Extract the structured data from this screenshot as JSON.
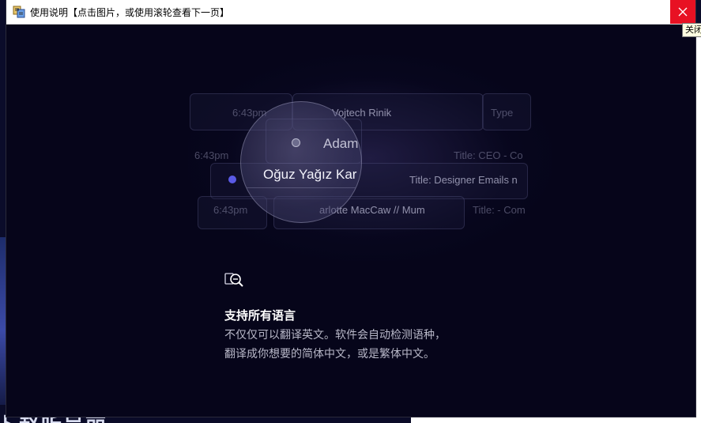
{
  "window": {
    "title": "使用说明【点击图片，或使用滚轮查看下一页】",
    "close_tooltip": "关闭"
  },
  "desktop": {
    "bottom_text": "卜赵听吴丽"
  },
  "illustration": {
    "rows": [
      {
        "time": "6:43pm",
        "name": "Vojtech Rinik",
        "title": "Type"
      },
      {
        "time": "6:43pm",
        "name": "Adam",
        "title": "Title: CEO - Co"
      },
      {
        "time": "",
        "name": "Oğuz Yağız Kar",
        "title": "Title: Designer Emails n"
      },
      {
        "time": "6:43pm",
        "name": "arlotte MacCaw // Mum",
        "title": "Title: - Com"
      }
    ],
    "accent_color": "#5a5ae6"
  },
  "feature": {
    "icon": "translate-search-icon",
    "title": "支持所有语言",
    "desc_line1": "不仅仅可以翻译英文。软件会自动检测语种，",
    "desc_line2": "翻译成你想要的简体中文，或是繁体中文。"
  }
}
